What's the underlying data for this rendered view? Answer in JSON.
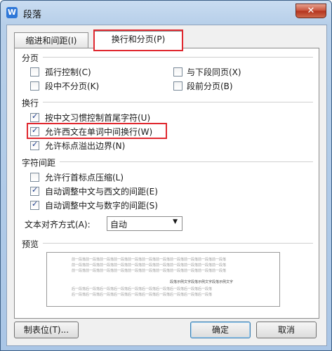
{
  "window": {
    "title": "段落",
    "app_icon_letter": "W",
    "close_glyph": "✕"
  },
  "tabs": [
    {
      "label": "缩进和间距(I)"
    },
    {
      "label": "换行和分页(P)"
    }
  ],
  "pagination": {
    "heading": "分页",
    "options": [
      {
        "label": "孤行控制(C)",
        "checked": false
      },
      {
        "label": "与下段同页(X)",
        "checked": false
      },
      {
        "label": "段中不分页(K)",
        "checked": false
      },
      {
        "label": "段前分页(B)",
        "checked": false
      }
    ]
  },
  "line_break": {
    "heading": "换行",
    "options": [
      {
        "label": "按中文习惯控制首尾字符(U)",
        "checked": true
      },
      {
        "label": "允许西文在单词中间换行(W)",
        "checked": true
      },
      {
        "label": "允许标点溢出边界(N)",
        "checked": true
      }
    ]
  },
  "char_spacing": {
    "heading": "字符间距",
    "options": [
      {
        "label": "允许行首标点压缩(L)",
        "checked": false
      },
      {
        "label": "自动调整中文与西文的间距(E)",
        "checked": true
      },
      {
        "label": "自动调整中文与数字的间距(S)",
        "checked": true
      }
    ],
    "align_label": "文本对齐方式(A):",
    "align_value": "自动"
  },
  "preview": {
    "heading": "预览",
    "prev_text": "前一段落前一段落前一段落前一段落前一段落前一段落前一段落前一段落前一段落前一段落前一段落",
    "current_text": "段落示例文字段落示例文字段落示例文字",
    "next_text": "后一段落后一段落后一段落后一段落后一段落后一段落后一段落后一段落后一段落后一段落"
  },
  "buttons": {
    "tabs_label": "制表位(T)...",
    "ok": "确定",
    "cancel": "取消"
  },
  "colors": {
    "highlight_red": "#e0282f",
    "title_gradient": "#b7cfe9"
  }
}
